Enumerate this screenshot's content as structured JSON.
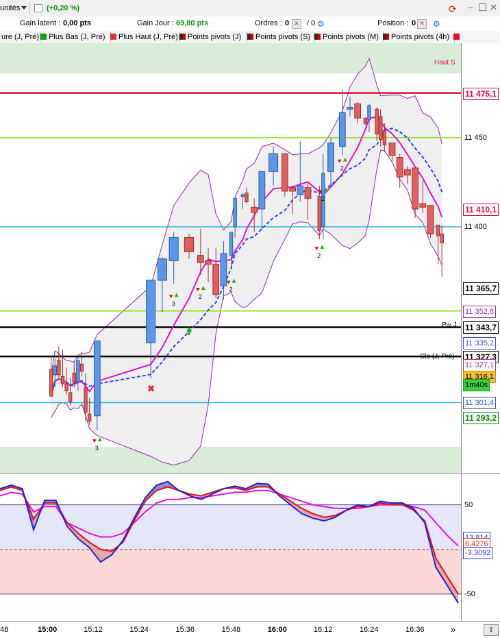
{
  "toolbar": {
    "units_label": "unités",
    "change_label": "(+0,20 %)"
  },
  "info": {
    "unrealized_label": "Gain latent :",
    "unrealized_value": "0,00 pts",
    "day_gain_label": "Gain Jour :",
    "day_gain_value": "69,80 pts",
    "orders_label": "Ordres :",
    "orders_a": "0",
    "orders_b": "/ 0",
    "position_label": "Position :",
    "position_value": "0"
  },
  "legend": [
    {
      "label": "ure (J, Pré)",
      "color": ""
    },
    {
      "label": "Plus Bas (J, Pré)",
      "color": "#10a010"
    },
    {
      "label": "Plus Haut (J, Pré)",
      "color": "#e03030"
    },
    {
      "label": "Points pivots (J)",
      "color": "#2a2a2a"
    },
    {
      "label": "Points pivots (S)",
      "color": "#2a2a2a"
    },
    {
      "label": "Points pivots (M)",
      "color": "#2a2a2a"
    },
    {
      "label": "Points pivots (4h)",
      "color": "#2a2a2a"
    }
  ],
  "chart_data": [
    {
      "type": "candlestick",
      "title": "",
      "y_range": [
        11262,
        11503
      ],
      "candles": [
        {
          "t": "15:01",
          "o": 11320,
          "h": 11328,
          "l": 11305,
          "c": 11305
        },
        {
          "t": "15:02",
          "o": 11317,
          "h": 11326,
          "l": 11310,
          "c": 11322
        },
        {
          "t": "15:03",
          "o": 11325,
          "h": 11333,
          "l": 11315,
          "c": 11317
        },
        {
          "t": "15:04",
          "o": 11316,
          "h": 11331,
          "l": 11310,
          "c": 11312
        },
        {
          "t": "15:05",
          "o": 11312,
          "h": 11321,
          "l": 11306,
          "c": 11308
        },
        {
          "t": "15:06",
          "o": 11307,
          "h": 11315,
          "l": 11300,
          "c": 11302
        },
        {
          "t": "15:07",
          "o": 11318,
          "h": 11325,
          "l": 11310,
          "c": 11313
        },
        {
          "t": "15:08",
          "o": 11313,
          "h": 11327,
          "l": 11308,
          "c": 11325
        },
        {
          "t": "15:09",
          "o": 11323,
          "h": 11330,
          "l": 11316,
          "c": 11319
        },
        {
          "t": "15:10",
          "o": 11310,
          "h": 11318,
          "l": 11291,
          "c": 11296
        },
        {
          "t": "15:11",
          "o": 11295,
          "h": 11304,
          "l": 11289,
          "c": 11291
        },
        {
          "t": "15:13",
          "o": 11294,
          "h": 11336,
          "l": 11286,
          "c": 11336
        },
        {
          "t": "15:27",
          "o": 11335,
          "h": 11370,
          "l": 11315,
          "c": 11370
        },
        {
          "t": "15:30",
          "o": 11370,
          "h": 11383,
          "l": 11352,
          "c": 11382
        },
        {
          "t": "15:33",
          "o": 11381,
          "h": 11397,
          "l": 11368,
          "c": 11394
        },
        {
          "t": "15:37",
          "o": 11394,
          "h": 11396,
          "l": 11382,
          "c": 11386
        },
        {
          "t": "15:40",
          "o": 11384,
          "h": 11399,
          "l": 11373,
          "c": 11380
        },
        {
          "t": "15:42",
          "o": 11381,
          "h": 11388,
          "l": 11369,
          "c": 11379
        },
        {
          "t": "15:44",
          "o": 11379,
          "h": 11388,
          "l": 11360,
          "c": 11362
        },
        {
          "t": "15:46",
          "o": 11367,
          "h": 11392,
          "l": 11359,
          "c": 11385
        },
        {
          "t": "15:48",
          "o": 11384,
          "h": 11397,
          "l": 11376,
          "c": 11397
        },
        {
          "t": "15:49",
          "o": 11400,
          "h": 11416,
          "l": 11394,
          "c": 11416
        },
        {
          "t": "15:51",
          "o": 11417,
          "h": 11419,
          "l": 11410,
          "c": 11418
        },
        {
          "t": "15:52",
          "o": 11419,
          "h": 11422,
          "l": 11413,
          "c": 11414
        },
        {
          "t": "15:54",
          "o": 11411,
          "h": 11416,
          "l": 11397,
          "c": 11408
        },
        {
          "t": "15:56",
          "o": 11410,
          "h": 11431,
          "l": 11398,
          "c": 11431
        },
        {
          "t": "15:59",
          "o": 11431,
          "h": 11445,
          "l": 11423,
          "c": 11441
        },
        {
          "t": "16:02",
          "o": 11441,
          "h": 11438,
          "l": 11417,
          "c": 11420
        },
        {
          "t": "16:04",
          "o": 11422,
          "h": 11423,
          "l": 11407,
          "c": 11420
        },
        {
          "t": "16:06",
          "o": 11418,
          "h": 11448,
          "l": 11414,
          "c": 11423
        },
        {
          "t": "16:08",
          "o": 11422,
          "h": 11425,
          "l": 11404,
          "c": 11416
        },
        {
          "t": "16:11",
          "o": 11417,
          "h": 11423,
          "l": 11393,
          "c": 11398
        },
        {
          "t": "16:12",
          "o": 11400,
          "h": 11441,
          "l": 11393,
          "c": 11430
        },
        {
          "t": "16:14",
          "o": 11431,
          "h": 11450,
          "l": 11423,
          "c": 11447
        },
        {
          "t": "16:17",
          "o": 11445,
          "h": 11477,
          "l": 11440,
          "c": 11464
        },
        {
          "t": "16:19",
          "o": 11466,
          "h": 11473,
          "l": 11462,
          "c": 11467
        },
        {
          "t": "16:21",
          "o": 11469,
          "h": 11470,
          "l": 11458,
          "c": 11461
        },
        {
          "t": "16:23",
          "o": 11461,
          "h": 11458,
          "l": 11457,
          "c": 11458
        },
        {
          "t": "16:24",
          "o": 11460,
          "h": 11469,
          "l": 11453,
          "c": 11468
        },
        {
          "t": "16:26",
          "o": 11466,
          "h": 11467,
          "l": 11448,
          "c": 11452
        },
        {
          "t": "16:27",
          "o": 11462,
          "h": 11466,
          "l": 11445,
          "c": 11449
        },
        {
          "t": "16:28",
          "o": 11454,
          "h": 11458,
          "l": 11442,
          "c": 11446
        },
        {
          "t": "16:30",
          "o": 11447,
          "h": 11446,
          "l": 11437,
          "c": 11440
        },
        {
          "t": "16:32",
          "o": 11439,
          "h": 11441,
          "l": 11422,
          "c": 11428
        },
        {
          "t": "16:34",
          "o": 11432,
          "h": 11434,
          "l": 11424,
          "c": 11429
        },
        {
          "t": "16:36",
          "o": 11433,
          "h": 11431,
          "l": 11405,
          "c": 11410
        },
        {
          "t": "16:38",
          "o": 11413,
          "h": 11426,
          "l": 11408,
          "c": 11411
        },
        {
          "t": "16:40",
          "o": 11412,
          "h": 11412,
          "l": 11394,
          "c": 11396
        },
        {
          "t": "16:42",
          "o": 11401,
          "h": 11401,
          "l": 11379,
          "c": 11395
        },
        {
          "t": "16:43",
          "o": 11396,
          "h": 11401,
          "l": 11372,
          "c": 11391
        }
      ],
      "horizontal_lines": [
        {
          "name": "Haut S",
          "value": 11475.1,
          "color": "#e0103c"
        },
        {
          "name": "",
          "value": 11450,
          "color": "#88dd00"
        },
        {
          "name": "",
          "value": 11400,
          "color": "#2ab0e8"
        },
        {
          "name": "",
          "value": 11352.8,
          "color": "#88dd00"
        },
        {
          "name": "Piv J",
          "value": 11343.7,
          "color": "#000000"
        },
        {
          "name": "Clo (J, Pré)",
          "value": 11327.3,
          "color": "#000000"
        },
        {
          "name": "",
          "value": 11301.4,
          "color": "#2ab0e8"
        }
      ],
      "price_labels": [
        {
          "text": "11 475,1",
          "value": 11475.1,
          "color": "#e0103c",
          "bg": "#ffffff",
          "border": "#e0103c",
          "bold": true
        },
        {
          "text": "11 450",
          "value": 11450,
          "color": "#000000",
          "bg": "",
          "border": "",
          "bold": false
        },
        {
          "text": "11 410,1",
          "value": 11410.1,
          "color": "#e0103c",
          "bg": "#ffffff",
          "border": "#e0103c",
          "bold": true
        },
        {
          "text": "11 400",
          "value": 11400,
          "color": "#000000",
          "bg": "",
          "border": "",
          "bold": false
        },
        {
          "text": "11 365,7",
          "value": 11365.7,
          "color": "#000000",
          "bg": "#ffffff",
          "border": "#000000",
          "bold": true
        },
        {
          "text": "11 352,8",
          "value": 11352.8,
          "color": "#a0308a",
          "bg": "#ffffff",
          "border": "#a0308a",
          "bold": false
        },
        {
          "text": "11 343,7",
          "value": 11343.7,
          "color": "#000000",
          "bg": "#ffffff",
          "border": "#000000",
          "bold": true
        },
        {
          "text": "11 335,2",
          "value": 11335.2,
          "color": "#3a50d0",
          "bg": "#ffffff",
          "border": "#3a50d0",
          "bold": false
        },
        {
          "text": "11 327,3",
          "value": 11327.3,
          "color": "#000000",
          "bg": "#ffffff",
          "border": "#000000",
          "bold": true
        },
        {
          "text": "11 327,1",
          "value": 11322.6,
          "color": "#a0308a",
          "bg": "#ffffff",
          "border": "#a0308a",
          "bold": false
        },
        {
          "text": "11 316,1",
          "value": 11316.1,
          "color": "#000000",
          "bg": "#f3c030",
          "border": "#c09010",
          "bold": false
        },
        {
          "text": "1m40s",
          "value": 11311.7,
          "color": "#000000",
          "bg": "#3ccc3c",
          "border": "#1a9a1a",
          "bold": false
        },
        {
          "text": "11 301,4",
          "value": 11301.4,
          "color": "#3a50d0",
          "bg": "#ffffff",
          "border": "#3a50d0",
          "bold": false
        },
        {
          "text": "11 293,2",
          "value": 11293.2,
          "color": "#0a8a0a",
          "bg": "#ffffff",
          "border": "#0a8a0a",
          "bold": true
        }
      ],
      "markers": [
        {
          "t": "15:13",
          "kind": "down-up",
          "count": "3",
          "price": 11280
        },
        {
          "t": "15:33",
          "kind": "down-up",
          "count": "3",
          "price": 11361
        },
        {
          "t": "15:40",
          "kind": "down-up",
          "count": "2",
          "price": 11365
        },
        {
          "t": "15:48",
          "kind": "down-up",
          "count": "2",
          "price": 11369
        },
        {
          "t": "16:11",
          "kind": "down-up",
          "count": "2",
          "price": 11388
        },
        {
          "t": "16:12",
          "kind": "down-up",
          "count": "2",
          "price": 11420
        },
        {
          "t": "16:17",
          "kind": "down-up",
          "count": "2",
          "price": 11437
        },
        {
          "t": "15:37",
          "kind": "up",
          "count": "",
          "price": 11342
        },
        {
          "t": "15:27",
          "kind": "cross",
          "count": "",
          "price": 11309
        }
      ]
    },
    {
      "type": "line",
      "title": "",
      "y_range": [
        -80,
        85
      ],
      "reference_lines": [
        50,
        0,
        -50
      ],
      "tick_labels": [
        "50",
        "-50"
      ],
      "value_labels": [
        {
          "text": "13,814",
          "value": 13.8,
          "color": "#3a3ad0"
        },
        {
          "text": "6,4276",
          "value": 6.4,
          "color": "#e02020"
        },
        {
          "text": "-3,3092",
          "value": -3.3,
          "color": "#3a3ad0"
        }
      ],
      "series": [
        {
          "name": "",
          "color": "#2020d0",
          "values": [
            68,
            72,
            68,
            22,
            55,
            55,
            26,
            12,
            2,
            -14,
            -6,
            10,
            35,
            58,
            72,
            76,
            66,
            60,
            56,
            62,
            68,
            71,
            68,
            74,
            73,
            60,
            50,
            40,
            35,
            32,
            36,
            44,
            50,
            48,
            54,
            52,
            52,
            46,
            30,
            -20,
            -40,
            -60
          ]
        },
        {
          "name": "",
          "color": "#e01010",
          "values": [
            66,
            70,
            66,
            34,
            52,
            52,
            30,
            18,
            8,
            0,
            -2,
            8,
            32,
            54,
            66,
            70,
            66,
            62,
            60,
            64,
            68,
            69,
            66,
            70,
            70,
            62,
            54,
            46,
            40,
            36,
            38,
            44,
            48,
            48,
            52,
            50,
            50,
            44,
            32,
            -10,
            -30,
            -50
          ]
        },
        {
          "name": "",
          "color": "#e010e0",
          "values": [
            60,
            64,
            62,
            42,
            48,
            48,
            30,
            24,
            18,
            14,
            14,
            18,
            30,
            42,
            52,
            56,
            56,
            58,
            58,
            60,
            62,
            64,
            64,
            66,
            66,
            62,
            58,
            54,
            50,
            48,
            46,
            46,
            46,
            48,
            50,
            50,
            50,
            48,
            44,
            30,
            16,
            4
          ]
        }
      ]
    }
  ],
  "time_axis": {
    "labels": [
      {
        "text": "48",
        "x_time": "14:48"
      },
      {
        "text": "15:00",
        "x_time": "15:00",
        "bold": true
      },
      {
        "text": "15:12",
        "x_time": "15:12"
      },
      {
        "text": "15:24",
        "x_time": "15:24"
      },
      {
        "text": "15:36",
        "x_time": "15:36"
      },
      {
        "text": "15:48",
        "x_time": "15:48"
      },
      {
        "text": "16:00",
        "x_time": "16:00",
        "bold": true
      },
      {
        "text": "16:12",
        "x_time": "16:12"
      },
      {
        "text": "16:24",
        "x_time": "16:24"
      },
      {
        "text": "16:36",
        "x_time": "16:36"
      }
    ],
    "scroll_label": "»"
  },
  "annotations": {
    "haut_s": "Haut S",
    "piv_j": "Piv J",
    "clo": "Clo (J, Pré)"
  },
  "colors": {
    "bull": "#5b97e8",
    "bear": "#e06060",
    "bollinger": "#8a2aa8",
    "ma_fast": "#e010d0",
    "ma_slow": "#2a40e0"
  }
}
